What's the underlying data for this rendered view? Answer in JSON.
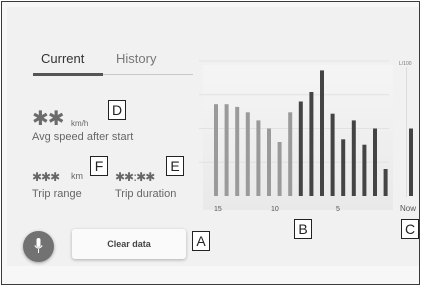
{
  "tabs": {
    "current": "Current",
    "history": "History"
  },
  "avg_speed": {
    "value": "✱✱",
    "unit": "km/h",
    "label": "Avg speed after start"
  },
  "trip_range": {
    "value": "✱✱✱",
    "unit": "km",
    "label": "Trip range"
  },
  "trip_duration": {
    "value": "✱✱:✱✱",
    "label": "Trip duration"
  },
  "clear_button": {
    "label": "Clear data"
  },
  "voice_button": {
    "icon": "microphone-icon"
  },
  "callouts": {
    "a": "A",
    "b": "B",
    "c": "C",
    "d": "D",
    "e": "E",
    "f": "F"
  },
  "colors": {
    "accent_bar_dark": "#444444",
    "bar_light": "#9a9a9a",
    "button_voice": "#727272"
  },
  "chart_data": {
    "type": "bar",
    "x_ticks": [
      "15",
      "10",
      "5"
    ],
    "now_label": "Now",
    "right_partial_label": "L/100",
    "values": [
      0.68,
      0.68,
      0.66,
      0.62,
      0.56,
      0.5,
      0.4,
      0.62,
      0.7,
      0.77,
      0.93,
      0.61,
      0.42,
      0.56,
      0.38,
      0.5,
      0.2
    ],
    "dark_bars_from_index": 8,
    "ylim": [
      0,
      1
    ],
    "grid": true
  }
}
